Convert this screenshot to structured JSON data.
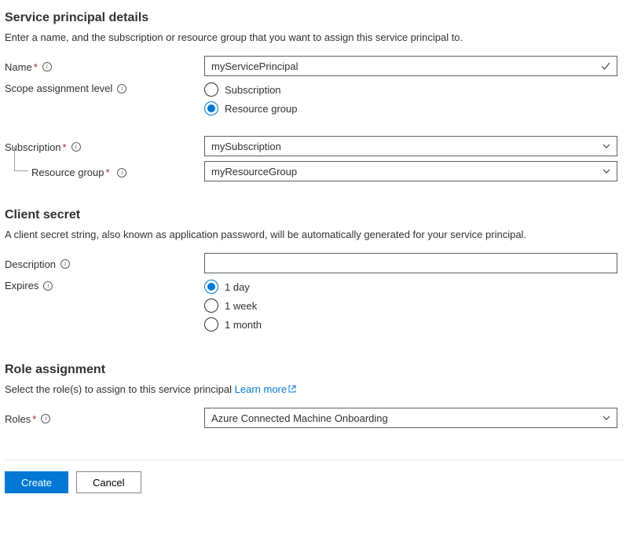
{
  "sp": {
    "heading": "Service principal details",
    "description": "Enter a name, and the subscription or resource group that you want to assign this service principal to.",
    "name_label": "Name",
    "name_value": "myServicePrincipal",
    "scope_label": "Scope assignment level",
    "scope_options": {
      "sub": "Subscription",
      "rg": "Resource group"
    },
    "scope_selected": "rg",
    "subscription_label": "Subscription",
    "subscription_value": "mySubscription",
    "resource_group_label": "Resource group",
    "resource_group_value": "myResourceGroup"
  },
  "secret": {
    "heading": "Client secret",
    "description": "A client secret string, also known as application password, will be automatically generated for your service principal.",
    "description_label": "Description",
    "description_value": "",
    "expires_label": "Expires",
    "expires_options": {
      "d1": "1 day",
      "w1": "1 week",
      "m1": "1 month"
    },
    "expires_selected": "d1"
  },
  "role": {
    "heading": "Role assignment",
    "description_prefix": "Select the role(s) to assign to this service principal ",
    "learn_more": "Learn more",
    "roles_label": "Roles",
    "roles_value": "Azure Connected Machine Onboarding"
  },
  "footer": {
    "create": "Create",
    "cancel": "Cancel"
  }
}
